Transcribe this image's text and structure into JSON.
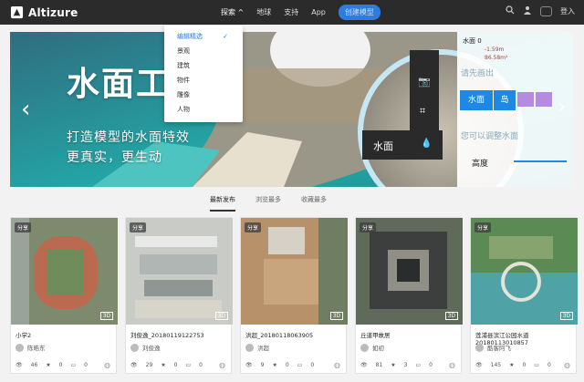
{
  "header": {
    "brand": "Altizure",
    "nav": [
      {
        "label": "探索 ^",
        "active": true
      },
      {
        "label": "地球"
      },
      {
        "label": "支持"
      },
      {
        "label": "App"
      }
    ],
    "create_label": "创建模型",
    "login_label": "登入"
  },
  "dropdown": {
    "items": [
      "编辑精选",
      "景观",
      "建筑",
      "物件",
      "雕像",
      "人物"
    ]
  },
  "hero": {
    "title": "水面工",
    "subtitle1": "打造模型的水面特效",
    "subtitle2": "更真实，更生动",
    "panel_title": "水面 0",
    "panel_v1": "-1.59m",
    "panel_v2": "86.58m²",
    "panel_hint": "请先画出",
    "panel_water": "水面",
    "panel_island": "岛",
    "panel_tip": "您可以调整水面",
    "panel_bright": "高度",
    "popup_label": "水面"
  },
  "tabs": [
    "最新发布",
    "浏览最多",
    "收藏最多"
  ],
  "cards": [
    {
      "tag": "分享",
      "title": "小学2",
      "author": "陈皓东",
      "views": "46",
      "stars": "0",
      "comments": "0"
    },
    {
      "tag": "分享",
      "title": "刘俊逸_20180119122753",
      "author": "刘俊逸",
      "views": "29",
      "stars": "0",
      "comments": "0"
    },
    {
      "tag": "分享",
      "title": "洪超_20180118063905",
      "author": "洪超",
      "views": "9",
      "stars": "0",
      "comments": "0"
    },
    {
      "tag": "分享",
      "title": "丘道甲故居",
      "author": "如初",
      "views": "81",
      "stars": "3",
      "comments": "0"
    },
    {
      "tag": "分享",
      "title": "莲浦县滨江公园水道20180113010857",
      "author": "酷客阿飞",
      "views": "145",
      "stars": "0",
      "comments": "0"
    }
  ]
}
